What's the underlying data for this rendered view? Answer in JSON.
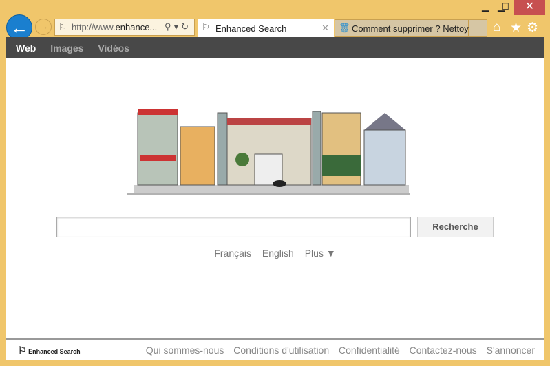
{
  "browser": {
    "url_prefix": "http://www.",
    "url_domain": "enhance...",
    "tabs": [
      {
        "title": "Enhanced Search"
      },
      {
        "title": "Comment supprimer ? Nettoy..."
      }
    ],
    "close_tab": "✕"
  },
  "window": {
    "minimize": "▁",
    "maximize": "☐",
    "close": "✕"
  },
  "nav": {
    "items": [
      "Web",
      "Images",
      "Vidéos"
    ]
  },
  "search": {
    "value": "",
    "button": "Recherche"
  },
  "languages": [
    "Français",
    "English",
    "Plus ▼"
  ],
  "footer": {
    "logo": "Enhanced Search",
    "links": [
      "Qui sommes-nous",
      "Conditions d'utilisation",
      "Confidentialité",
      "Contactez-nous",
      "S'annoncer"
    ]
  },
  "colors": {
    "frame": "#f0c66b",
    "nav": "#484848",
    "back": "#1a7fcf",
    "close": "#c75050"
  }
}
